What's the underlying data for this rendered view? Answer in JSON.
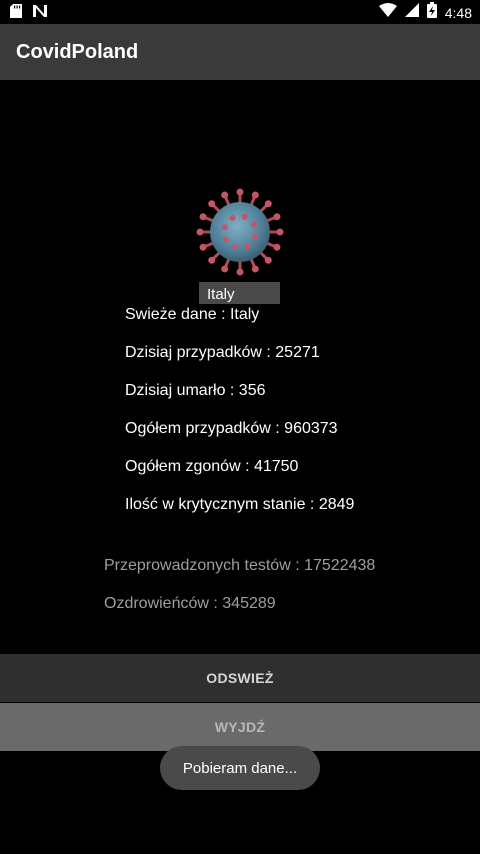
{
  "status_bar": {
    "time": "4:48",
    "icons": [
      "sd-card-icon",
      "n-notification-icon",
      "wifi-icon",
      "cellular-signal-icon",
      "battery-charging-icon"
    ]
  },
  "app": {
    "title": "CovidPoland"
  },
  "image": {
    "name": "coronavirus-icon"
  },
  "country_input": {
    "value": "Italy"
  },
  "stats": {
    "fresh_data": "Swieże dane : Italy",
    "today_cases": "Dzisiaj przypadków : 25271",
    "today_deaths": "Dzisiaj umarło : 356",
    "total_cases": "Ogółem przypadków : 960373",
    "total_deaths": "Ogółem zgonów : 41750",
    "critical": "Ilość w krytycznym stanie : 2849",
    "tests": "Przeprowadzonych testów : 17522438",
    "recovered": "Ozdrowieńców : 345289"
  },
  "buttons": {
    "refresh": "ODSWIEŻ",
    "exit": "WYJDŹ"
  },
  "toast": {
    "message": "Pobieram dane..."
  },
  "colors": {
    "app_bar": "#3a3a3a",
    "background": "#000000",
    "gray_text": "#9e9e9e"
  }
}
